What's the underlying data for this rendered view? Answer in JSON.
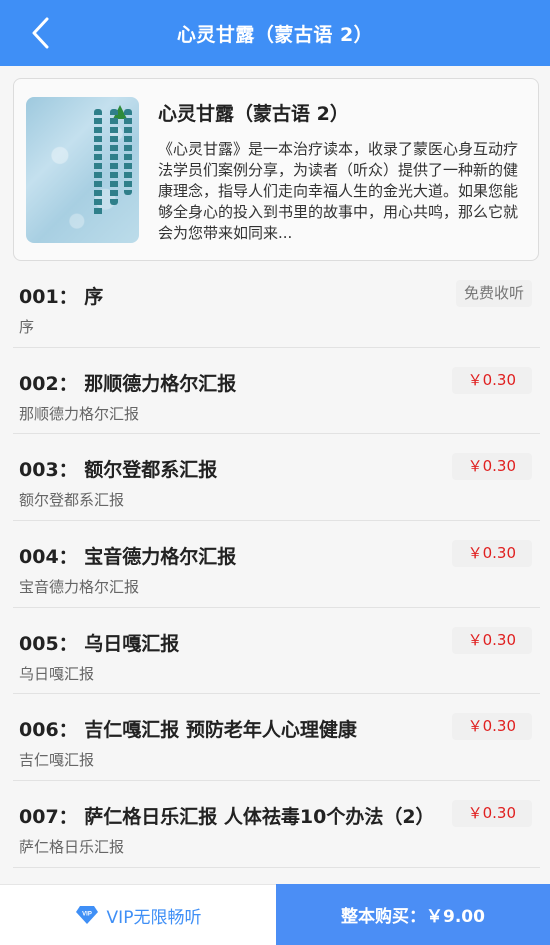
{
  "header": {
    "title": "心灵甘露（蒙古语 2）"
  },
  "book": {
    "title": "心灵甘露（蒙古语 2）",
    "description": "《心灵甘露》是一本治疗读本，收录了蒙医心身互动疗法学员们案例分享，为读者（听众）提供了一种新的健康理念，指导人们走向幸福人生的金光大道。如果您能够全身心的投入到书里的故事中，用心共鸣，那么它就会为您带来如同来..."
  },
  "episodes": [
    {
      "title": "001： 序",
      "subtitle": "序",
      "price": "免费收听",
      "free": true
    },
    {
      "title": "002： 那顺德力格尔汇报",
      "subtitle": "那顺德力格尔汇报",
      "price": "￥0.30",
      "free": false
    },
    {
      "title": "003： 额尔登都系汇报",
      "subtitle": "额尔登都系汇报",
      "price": "￥0.30",
      "free": false
    },
    {
      "title": "004： 宝音德力格尔汇报",
      "subtitle": "宝音德力格尔汇报",
      "price": "￥0.30",
      "free": false
    },
    {
      "title": "005： 乌日嘎汇报",
      "subtitle": "乌日嘎汇报",
      "price": "￥0.30",
      "free": false
    },
    {
      "title": "006： 吉仁嘎汇报 预防老年人心理健康",
      "subtitle": "吉仁嘎汇报",
      "price": "￥0.30",
      "free": false
    },
    {
      "title": "007： 萨仁格日乐汇报 人体祛毒10个办法（2）",
      "subtitle": "萨仁格日乐汇报",
      "price": "￥0.30",
      "free": false
    }
  ],
  "bottom_bar": {
    "vip_label": "VIP无限畅听",
    "buy_label": "整本购买：￥9.00"
  },
  "colors": {
    "primary": "#3f8ff6",
    "price": "#e02020"
  },
  "icons": {
    "back": "chevron-left-icon",
    "vip": "vip-diamond-icon"
  }
}
